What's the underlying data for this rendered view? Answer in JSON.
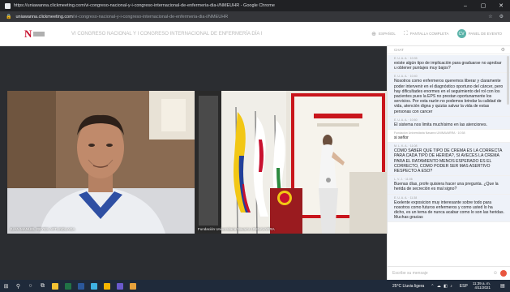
{
  "browser": {
    "window_title": "https://uniawanna.clickmeeting.com/vi-congreso-nacional-y-i-congreso-internacional-de-enfermeria-dia-i/NMEUHR - Google Chrome",
    "address_host": "uniawanna.clickmeeting.com",
    "address_path": "/vi-congreso-nacional-y-i-congreso-internacional-de-enfermeria-dia-i/NMEUHR",
    "minimize": "–",
    "maximize": "▢",
    "close": "✕"
  },
  "header": {
    "event_title": "VI CONGRESO NACIONAL Y I CONGRESO INTERNACIONAL DE ENFERMERÍA DÍA I",
    "language_label": "ESPAÑOL",
    "fullscreen_label": "PANTALLA COMPLETA",
    "avatar_initials": "CV",
    "panel_label": "PANEL DE EVENTO"
  },
  "videos": {
    "left_label": "JUAN MANUEL REYES ARTUNDUAGA",
    "right_label": "Fundación Universitaria Navarra UNINAVARRA"
  },
  "chat": {
    "title": "CHAT",
    "messages": [
      {
        "who": "E. U. A. A. · 10:35",
        "text": "existe algún tipo de implicación para graduarse no aprobar u obtener puntajes muy bajos?",
        "alt": true
      },
      {
        "who": "E. U. A. A. · 10:40",
        "text": "Nosotros como enfermeros queremos liberar y claramente poder intervenir en el diagnóstico oportuno del cáncer, pero hay dificultades enormes en el seguimiento del rol con los pacientes pues la EPS no prestan oportunamente los servicios. Por esta razón no podemos brindar la calidad de vida, atención digna y quizás salvar la vida de estas personas con cancer",
        "alt": true
      },
      {
        "who": "E. U. A. A. · 10:50",
        "text": "El sistema nos limita muchísimo en las atenciones.",
        "alt": true
      },
      {
        "who": "Fundación Universitaria Navarra UNINAVARRA · 10:58",
        "text": "si señor",
        "alt": false
      },
      {
        "who": "M. L. K. A. · 11:08",
        "text": "COMO SABER QUE TIPO DE CREMA ES LA CORRECTA PARA CADA TIPO DE HERIDA?, SI AVECES LA CREMA PARA EL RATAMIENTO MENOS ESPERADO ES EL CORRECTO, COMO PODER SER MAS ASERTIVO RESPECTO A ESO?",
        "alt": true
      },
      {
        "who": "L. V. J. · 11:06",
        "text": "Buenas días, profe quisiera hacer una pregunta. ¿Que la herida de secreción es mal signo?",
        "alt": true
      },
      {
        "who": "E. U. A. A. · 11:38",
        "text": "Exelente exposicion muy interesante sobre todo para nosotros como futuros enfermeros y como usted lo ha dicho, es un tema de nunca acabar como lo son las heridas. Muchas gracias",
        "alt": true
      }
    ],
    "input_placeholder": "Escribe su mensaje"
  },
  "taskbar": {
    "weather": "25°C  Lluvia ligera",
    "language": "ESP",
    "time": "11:39 a. m.",
    "date": "4/11/2021"
  },
  "colors": {
    "brand_red": "#c8102e",
    "accent_teal": "#5bb3a9",
    "send_orange": "#e8553e",
    "taskbar": "#1f2a3a"
  }
}
